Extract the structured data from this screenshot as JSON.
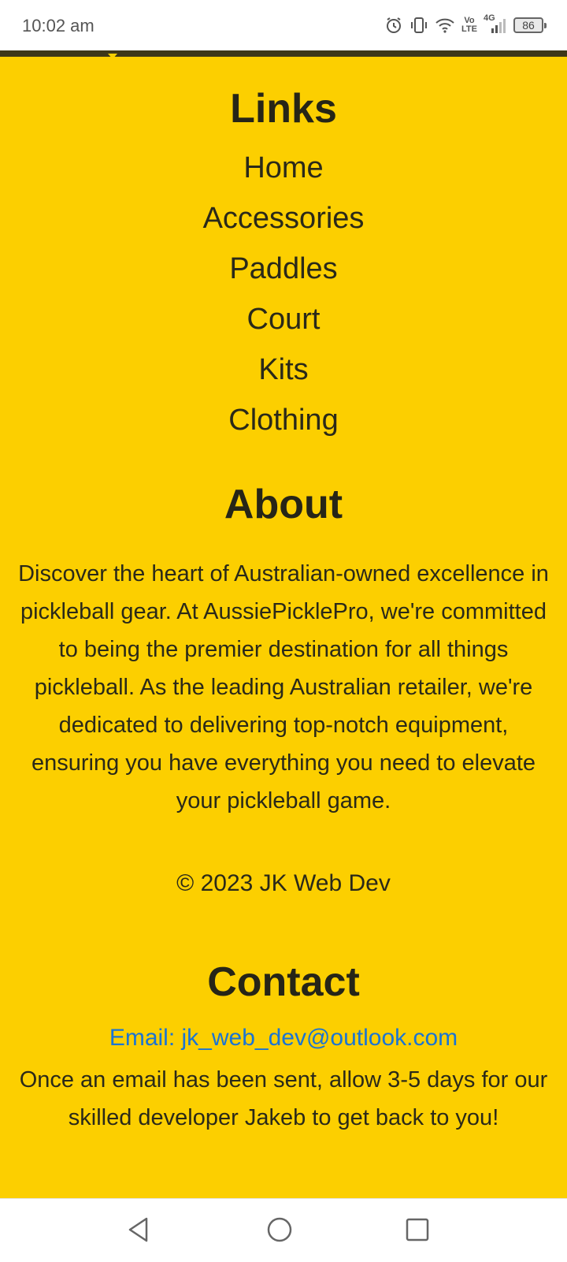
{
  "status_bar": {
    "time": "10:02 am",
    "icons": [
      "alarm-icon",
      "vibrate-icon",
      "wifi-icon",
      "volte-icon",
      "signal-4g-icon"
    ],
    "volte_label_top": "Vo",
    "volte_label_bottom": "LTE",
    "network_label": "4G",
    "battery_level": "86"
  },
  "footer": {
    "background_color": "#fccf00",
    "links": {
      "heading": "Links",
      "items": [
        {
          "label": "Home"
        },
        {
          "label": "Accessories"
        },
        {
          "label": "Paddles"
        },
        {
          "label": "Court"
        },
        {
          "label": "Kits"
        },
        {
          "label": "Clothing"
        }
      ]
    },
    "about": {
      "heading": "About",
      "text": "Discover the heart of Australian-owned excellence in pickleball gear. At AussiePicklePro, we're committed to being the premier destination for all things pickleball. As the leading Australian retailer, we're dedicated to delivering top-notch equipment, ensuring you have everything you need to elevate your pickleball game.",
      "copyright": "© 2023 JK Web Dev"
    },
    "contact": {
      "heading": "Contact",
      "email": "Email: jk_web_dev@outlook.com",
      "note": "Once an email has been sent, allow 3-5 days for our skilled developer Jakeb to get back to you!"
    },
    "link_color": "#1a74d4"
  },
  "nav_bar": {
    "buttons": [
      "back-icon",
      "home-icon",
      "recents-icon"
    ]
  }
}
